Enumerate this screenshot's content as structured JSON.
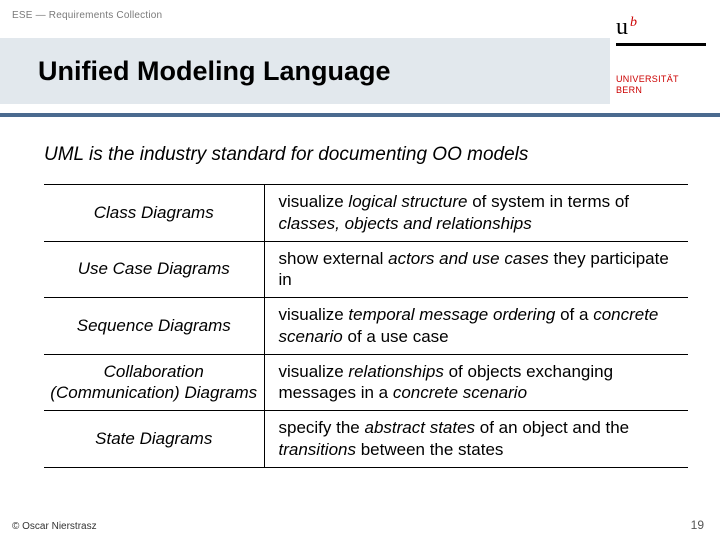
{
  "header": {
    "breadcrumb": "ESE — Requirements Collection",
    "title": "Unified Modeling Language",
    "logo": {
      "mark": "u",
      "sup": "b",
      "line1": "UNIVERSITÄT",
      "line2": "BERN"
    }
  },
  "intro": "UML is the industry standard for documenting OO models",
  "rows": [
    {
      "name": "Class Diagrams",
      "pre1": "visualize ",
      "em1": "logical structure",
      "mid1": " of system in terms of ",
      "em2": "classes, objects and relationships",
      "post": ""
    },
    {
      "name": "Use Case Diagrams",
      "pre1": "show external ",
      "em1": "actors and use cases",
      "mid1": " they participate in",
      "em2": "",
      "post": ""
    },
    {
      "name": "Sequence Diagrams",
      "pre1": "visualize ",
      "em1": "temporal message ordering",
      "mid1": " of a ",
      "em2": "concrete scenario",
      "post": " of a use case"
    },
    {
      "name": "Collaboration (Communication) Diagrams",
      "pre1": "visualize ",
      "em1": "relationships",
      "mid1": " of objects exchanging messages in a ",
      "em2": "concrete scenario",
      "post": ""
    },
    {
      "name": "State Diagrams",
      "pre1": "specify the ",
      "em1": "abstract states",
      "mid1": " of an object and the ",
      "em2": "transitions",
      "post": " between the states"
    }
  ],
  "footer": {
    "copyright": "© Oscar Nierstrasz",
    "page": "19"
  }
}
